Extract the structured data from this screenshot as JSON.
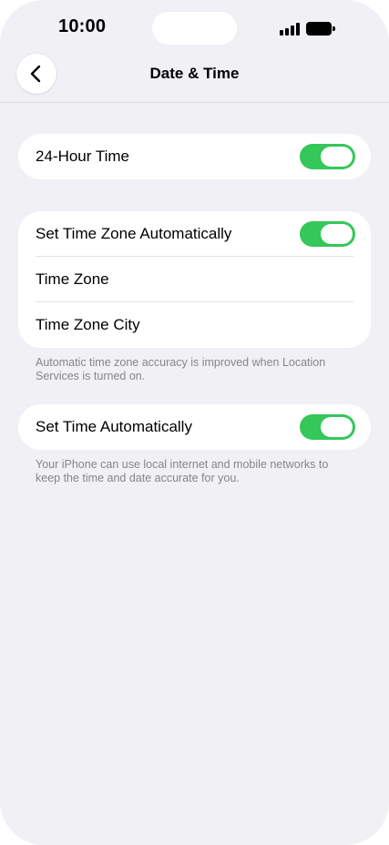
{
  "status_bar": {
    "time": "10:00"
  },
  "nav": {
    "title": "Date & Time",
    "back_icon": "chevron-left-icon"
  },
  "colors": {
    "toggle_on": "#34c759",
    "background": "#f0f0f5",
    "footer_text": "#85858b"
  },
  "group1": {
    "items": [
      {
        "label": "24-Hour Time",
        "toggle": true
      }
    ]
  },
  "group2": {
    "items": [
      {
        "label": "Set Time Zone Automatically",
        "toggle": true
      },
      {
        "label": "Time Zone"
      },
      {
        "label": "Time Zone City"
      }
    ],
    "footer": "Automatic time zone accuracy is improved when Location Services is turned on."
  },
  "group3": {
    "items": [
      {
        "label": "Set Time Automatically",
        "toggle": true
      }
    ],
    "footer": "Your iPhone can use local internet and mobile networks to keep the time and date accurate for you."
  }
}
